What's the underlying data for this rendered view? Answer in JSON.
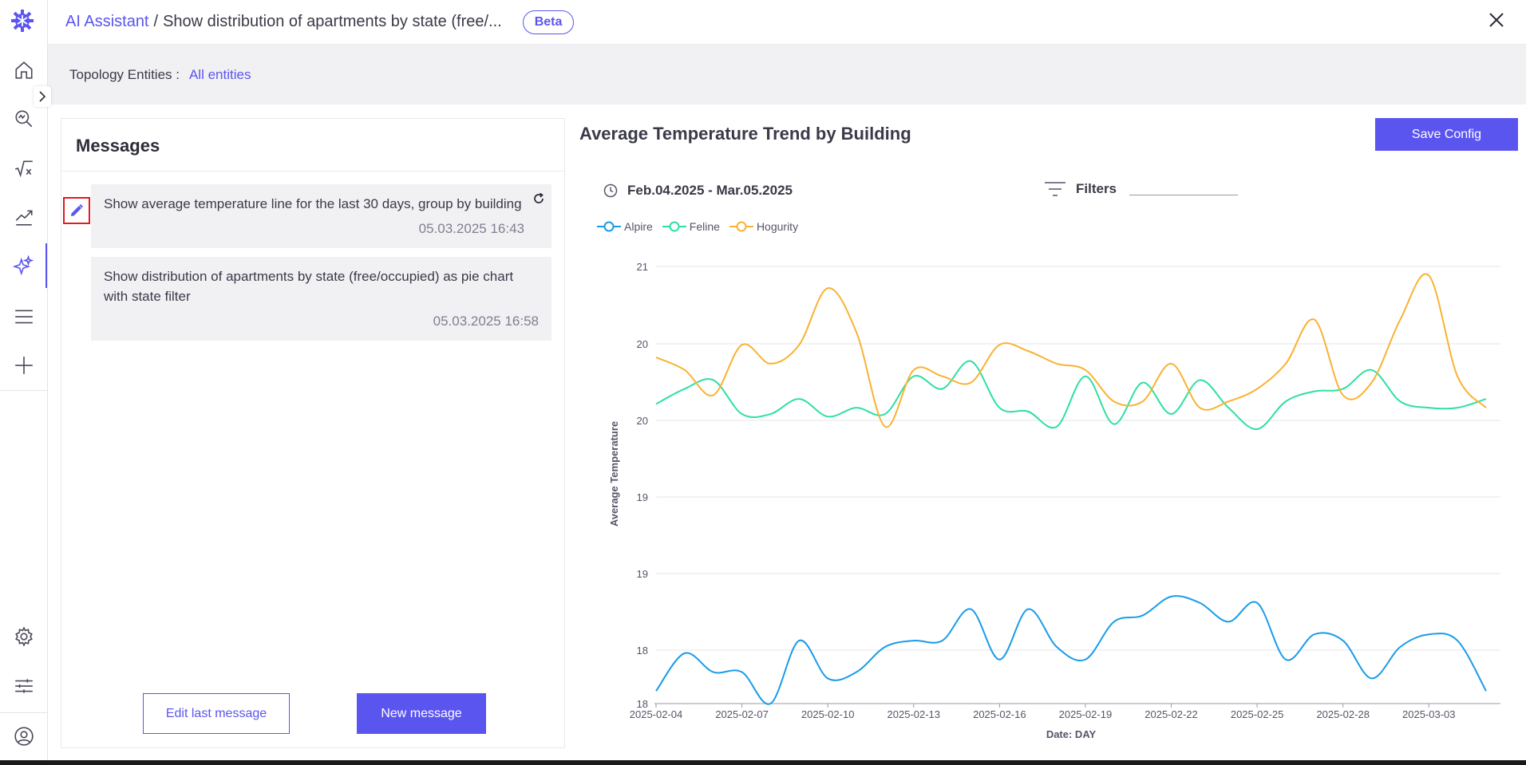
{
  "header": {
    "breadcrumb_link": "AI Assistant",
    "breadcrumb_sep": "/",
    "breadcrumb_current": "Show distribution of apartments by state (free/...",
    "badge": "Beta"
  },
  "topology": {
    "label": "Topology Entities :",
    "value": "All entities"
  },
  "messages": {
    "title": "Messages",
    "items": [
      {
        "text": "Show average temperature line for the last 30 days, group by building",
        "time": "05.03.2025 16:43"
      },
      {
        "text": "Show distribution of apartments by state (free/occupied) as pie chart with state filter",
        "time": "05.03.2025 16:58"
      }
    ],
    "edit_label": "Edit last message",
    "new_label": "New message"
  },
  "chart_panel": {
    "title": "Average Temperature Trend by Building",
    "save_label": "Save Config",
    "date_range": "Feb.04.2025 - Mar.05.2025",
    "filters_label": "Filters"
  },
  "colors": {
    "accent": "#5b55f0",
    "alpire": "#1a9be8",
    "feline": "#2ee0a0",
    "hogurity": "#f9b233"
  },
  "chart_data": {
    "type": "line",
    "ylabel": "Average Temperature",
    "xlabel": "Date: DAY",
    "ytick_labels": [
      "18",
      "18",
      "19",
      "19",
      "20",
      "20",
      "21"
    ],
    "ylim": [
      17.5,
      21.15
    ],
    "x_ticks": [
      "2025-02-04",
      "2025-02-07",
      "2025-02-10",
      "2025-02-13",
      "2025-02-16",
      "2025-02-19",
      "2025-02-22",
      "2025-02-25",
      "2025-02-28",
      "2025-03-03"
    ],
    "x": [
      "2025-02-04",
      "2025-02-05",
      "2025-02-06",
      "2025-02-07",
      "2025-02-08",
      "2025-02-09",
      "2025-02-10",
      "2025-02-11",
      "2025-02-12",
      "2025-02-13",
      "2025-02-14",
      "2025-02-15",
      "2025-02-16",
      "2025-02-17",
      "2025-02-18",
      "2025-02-19",
      "2025-02-20",
      "2025-02-21",
      "2025-02-22",
      "2025-02-23",
      "2025-02-24",
      "2025-02-25",
      "2025-02-26",
      "2025-02-27",
      "2025-02-28",
      "2025-03-01",
      "2025-03-02",
      "2025-03-03",
      "2025-03-04",
      "2025-03-05"
    ],
    "series": [
      {
        "name": "Alpire",
        "color": "#1a9be8",
        "values": [
          17.6,
          17.9,
          17.75,
          17.75,
          17.5,
          18.0,
          17.7,
          17.75,
          17.95,
          18.0,
          18.0,
          18.25,
          17.85,
          18.25,
          17.95,
          17.85,
          18.15,
          18.2,
          18.35,
          18.3,
          18.15,
          18.3,
          17.85,
          18.05,
          18.0,
          17.7,
          17.95,
          18.05,
          18.0,
          17.6
        ]
      },
      {
        "name": "Feline",
        "color": "#2ee0a0",
        "values": [
          19.88,
          20.0,
          20.07,
          19.8,
          19.8,
          19.92,
          19.78,
          19.85,
          19.8,
          20.1,
          20.0,
          20.22,
          19.85,
          19.82,
          19.7,
          20.1,
          19.72,
          20.05,
          19.8,
          20.07,
          19.85,
          19.68,
          19.9,
          19.98,
          20.0,
          20.15,
          19.9,
          19.85,
          19.85,
          19.92
        ]
      },
      {
        "name": "Hogurity",
        "color": "#f9b233",
        "values": [
          20.25,
          20.15,
          19.95,
          20.35,
          20.2,
          20.35,
          20.8,
          20.45,
          19.7,
          20.15,
          20.1,
          20.05,
          20.35,
          20.3,
          20.2,
          20.15,
          19.9,
          19.9,
          20.2,
          19.85,
          19.9,
          20.0,
          20.2,
          20.55,
          19.95,
          20.05,
          20.55,
          20.9,
          20.1,
          19.85
        ]
      }
    ]
  }
}
